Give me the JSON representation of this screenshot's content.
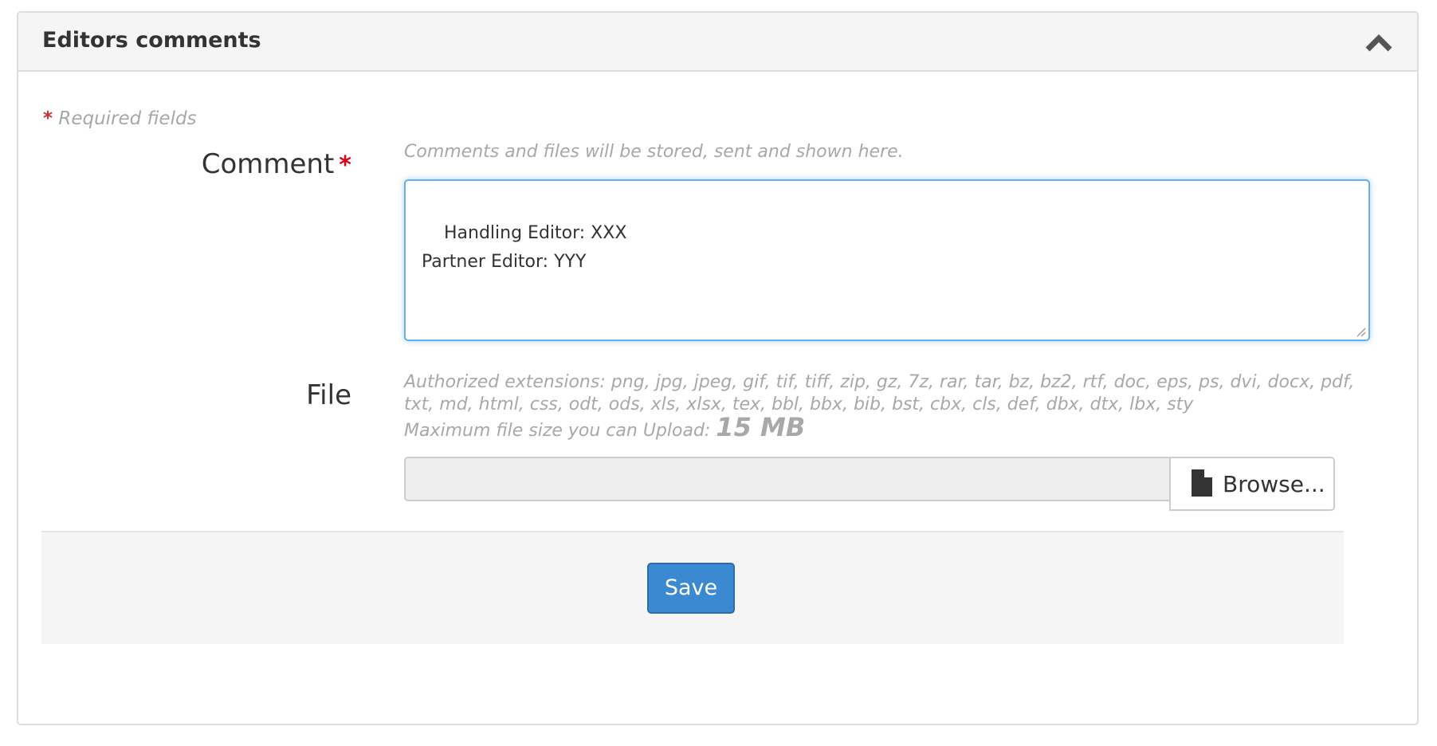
{
  "panel": {
    "title": "Editors comments",
    "collapse_icon": "chevron-up-icon"
  },
  "form": {
    "required_marker": "*",
    "required_note": "Required fields",
    "comment": {
      "label": "Comment",
      "required_marker": "*",
      "help": "Comments and files will be stored, sent and shown here.",
      "value": "Handling Editor: XXX\nPartner Editor: YYY"
    },
    "file": {
      "label": "File",
      "extensions_help": "Authorized extensions: png, jpg, jpeg, gif, tif, tiff, zip, gz, 7z, rar, tar, bz, bz2, rtf, doc, eps, ps, dvi, docx, pdf, txt, md, html, css, odt, ods, xls, xlsx, tex, bbl, bbx, bib, bst, cbx, cls, def, dbx, dtx, lbx, sty",
      "max_size_label": "Maximum file size you can Upload:",
      "max_size_value": "15 MB",
      "selected_file": "",
      "browse_label": "Browse...",
      "browse_icon": "file-icon"
    },
    "save_label": "Save"
  },
  "colors": {
    "primary": "#3b8ad1",
    "required": "#d9001b",
    "focus_border": "#66afe9"
  }
}
